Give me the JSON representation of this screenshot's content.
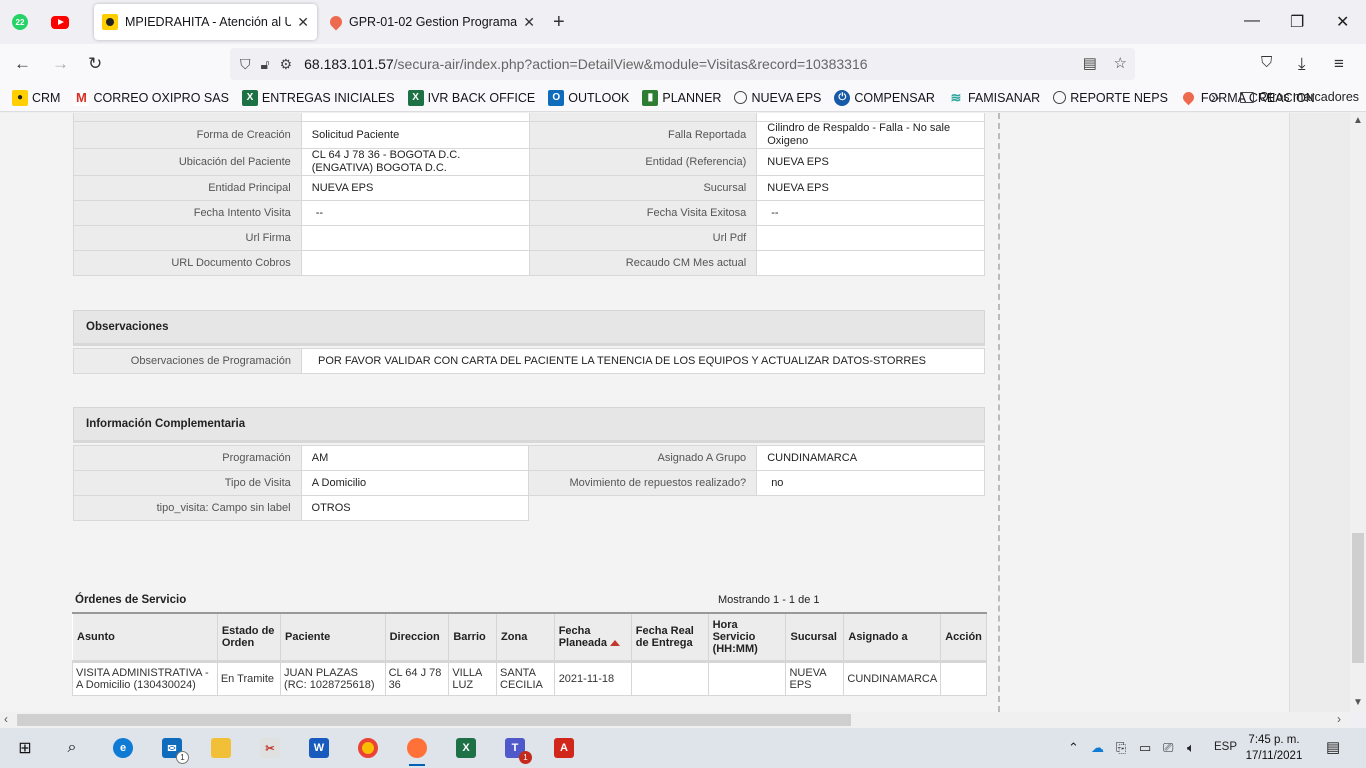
{
  "browser": {
    "pinned": [
      {
        "name": "whatsapp",
        "badge": "22"
      },
      {
        "name": "youtube"
      }
    ],
    "tabs": [
      {
        "title": "MPIEDRAHITA - Atención al Usu",
        "active": true
      },
      {
        "title": "GPR-01-02 Gestion Programació",
        "active": false
      }
    ],
    "new_tab_label": "+",
    "url": {
      "host": "68.183.101.57",
      "path": "/secura-air/index.php?action=DetailView&module=Visitas&record=10383316"
    },
    "bookmarks": [
      {
        "label": "CRM",
        "icon": "crm-icon"
      },
      {
        "label": "CORREO OXIPRO SAS",
        "icon": "gmail-icon"
      },
      {
        "label": "ENTREGAS INICIALES",
        "icon": "excel-icon"
      },
      {
        "label": "IVR BACK OFFICE",
        "icon": "excel-icon"
      },
      {
        "label": "OUTLOOK",
        "icon": "outlook-icon"
      },
      {
        "label": "PLANNER",
        "icon": "planner-icon"
      },
      {
        "label": "NUEVA EPS",
        "icon": "globe-icon"
      },
      {
        "label": "COMPENSAR",
        "icon": "compensar-icon"
      },
      {
        "label": "FAMISANAR",
        "icon": "famisanar-icon"
      },
      {
        "label": "REPORTE NEPS",
        "icon": "globe-icon"
      },
      {
        "label": "FORMA CREACION",
        "icon": "pin-icon"
      }
    ],
    "other_bookmarks": "Otros marcadores"
  },
  "detail": {
    "rows": [
      [
        "Forma de Creación",
        "Solicitud Paciente",
        "Falla Reportada",
        "Cilindro de Respaldo - Falla - No sale Oxigeno"
      ],
      [
        "Ubicación del Paciente",
        "CL 64 J 78 36 - BOGOTA D.C. (ENGATIVA) BOGOTA D.C.",
        "Entidad (Referencia)",
        "NUEVA EPS"
      ],
      [
        "Entidad Principal",
        "NUEVA EPS",
        "Sucursal",
        "NUEVA EPS"
      ],
      [
        "Fecha Intento Visita",
        "--",
        "Fecha Visita Exitosa",
        "--"
      ],
      [
        "Url Firma",
        "",
        "Url Pdf",
        ""
      ],
      [
        "URL Documento Cobros",
        "",
        "Recaudo CM Mes actual",
        ""
      ]
    ]
  },
  "observaciones": {
    "title": "Observaciones",
    "label": "Observaciones de Programación",
    "value": "POR FAVOR VALIDAR CON CARTA DEL PACIENTE LA TENENCIA DE LOS EQUIPOS Y ACTUALIZAR DATOS-STORRES"
  },
  "complementaria": {
    "title": "Información Complementaria",
    "rows": [
      [
        "Programación",
        "AM",
        "Asignado A Grupo",
        "CUNDINAMARCA"
      ],
      [
        "Tipo de Visita",
        "A Domicilio",
        "Movimiento de repuestos realizado?",
        "no"
      ]
    ],
    "last_label": "tipo_visita: Campo sin label",
    "last_value": "OTROS"
  },
  "ordenes": {
    "title": "Órdenes de Servicio",
    "mostrando": "Mostrando 1 - 1 de 1",
    "headers": [
      "Asunto",
      "Estado de Orden",
      "Paciente",
      "Direccion",
      "Barrio",
      "Zona",
      "Fecha Planeada",
      "Fecha Real de Entrega",
      "Hora Servicio (HH:MM)",
      "Sucursal",
      "Asignado a",
      "Acción"
    ],
    "rows": [
      [
        "VISITA ADMINISTRATIVA - A Domicilio (130430024)",
        "En Tramite",
        "JUAN PLAZAS (RC: 1028725618)",
        "CL 64 J 78 36",
        "VILLA LUZ",
        "SANTA CECILIA",
        "2021-11-18",
        "",
        "",
        "NUEVA EPS",
        "CUNDINAMARCA",
        ""
      ]
    ]
  },
  "taskbar": {
    "apps": [
      {
        "name": "start-button"
      },
      {
        "name": "search-button"
      },
      {
        "name": "edge"
      },
      {
        "name": "mail",
        "badge": "1"
      },
      {
        "name": "file-explorer"
      },
      {
        "name": "snipping-tool"
      },
      {
        "name": "word"
      },
      {
        "name": "chrome"
      },
      {
        "name": "firefox",
        "active": true
      },
      {
        "name": "excel"
      },
      {
        "name": "teams",
        "badge": "1"
      },
      {
        "name": "acrobat"
      }
    ],
    "language": "ESP",
    "time": "7:45 p. m.",
    "date": "17/11/2021"
  }
}
